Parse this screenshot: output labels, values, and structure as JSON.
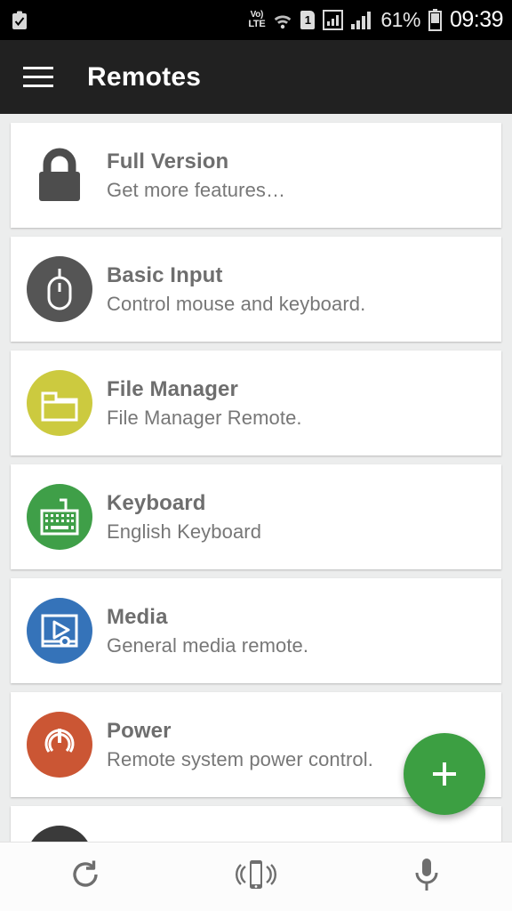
{
  "statusbar": {
    "left_icons": [
      {
        "name": "clipboard-check-icon"
      }
    ],
    "network_label_top": "Vo)",
    "network_label_bottom": "LTE",
    "wifi_icon": "wifi-icon",
    "sim_label": "1",
    "signal_icon_1": "signal-boxed-icon",
    "signal_icon_2": "signal-bars-icon",
    "battery_percent": "61%",
    "battery_icon": "battery-icon",
    "time": "09:39"
  },
  "appbar": {
    "menu_icon": "hamburger-menu-icon",
    "title": "Remotes"
  },
  "cards": [
    {
      "icon": "lock-icon",
      "icon_shape": "plain",
      "color": "#4d4d4d",
      "title": "Full Version",
      "subtitle": "Get more features…"
    },
    {
      "icon": "mouse-icon",
      "icon_shape": "circle",
      "color": "#555555",
      "title": "Basic Input",
      "subtitle": "Control mouse and keyboard."
    },
    {
      "icon": "folder-icon",
      "icon_shape": "circle",
      "color": "#ccca3f",
      "title": "File Manager",
      "subtitle": "File Manager Remote."
    },
    {
      "icon": "keyboard-icon",
      "icon_shape": "circle",
      "color": "#3f9f48",
      "title": "Keyboard",
      "subtitle": "English Keyboard"
    },
    {
      "icon": "media-play-icon",
      "icon_shape": "circle",
      "color": "#3573b9",
      "title": "Media",
      "subtitle": "General media remote."
    },
    {
      "icon": "power-icon",
      "icon_shape": "circle",
      "color": "#cb5634",
      "title": "Power",
      "subtitle": "Remote system power control."
    },
    {
      "icon": "partial-icon",
      "icon_shape": "circle",
      "color": "#3a3a3a",
      "title": "",
      "subtitle": ""
    }
  ],
  "fab": {
    "icon": "plus-icon",
    "color": "#3c9f42",
    "label": "+"
  },
  "bottombar": {
    "buttons": [
      {
        "icon": "refresh-icon"
      },
      {
        "icon": "device-vibrate-icon"
      },
      {
        "icon": "microphone-icon"
      }
    ]
  },
  "theme": {
    "appbar_bg": "#212121",
    "page_bg": "#eceded",
    "card_bg": "#ffffff",
    "title_color": "#6e6e6e",
    "subtitle_color": "#777777"
  }
}
